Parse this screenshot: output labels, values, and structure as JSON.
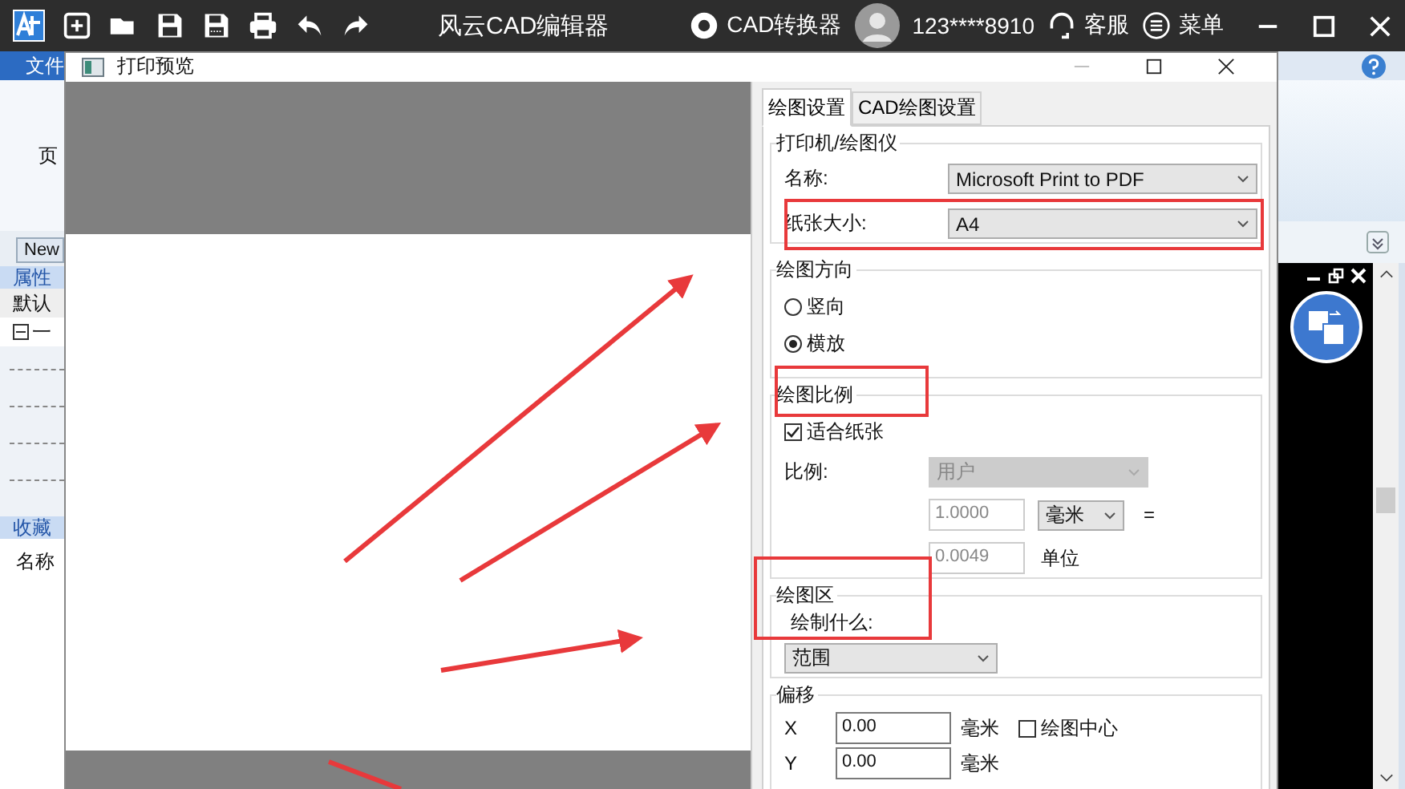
{
  "app_title_bar": {
    "title": "风云CAD编辑器",
    "converter": "CAD转换器",
    "user": "123****8910",
    "support": "客服",
    "menu": "菜单"
  },
  "background_app": {
    "menu_tab": "文件",
    "ribbon_label": "页",
    "doc_tab": "New",
    "properties_header": "属性",
    "properties_default": "默认",
    "tree_item": "一",
    "favorites_header": "收藏",
    "favorites_name": "名称"
  },
  "dialog": {
    "title": "打印预览",
    "tabs": [
      {
        "label": "绘图设置",
        "selected": true
      },
      {
        "label": "CAD绘图设置",
        "selected": false
      }
    ],
    "printer_group": {
      "title": "打印机/绘图仪",
      "name_label": "名称:",
      "name_value": "Microsoft Print to PDF",
      "paper_label": "纸张大小:",
      "paper_value": "A4"
    },
    "orientation_group": {
      "title": "绘图方向",
      "options": [
        {
          "label": "竖向",
          "selected": false
        },
        {
          "label": "横放",
          "selected": true
        }
      ]
    },
    "scale_group": {
      "title": "绘图比例",
      "fit_paper": {
        "label": "适合纸张",
        "checked": true
      },
      "scale_label": "比例:",
      "scale_select": {
        "value": "用户",
        "disabled": true
      },
      "mm_field": {
        "value": "1.0000",
        "disabled": true
      },
      "mm_unit": "毫米",
      "equals": "=",
      "unit_field": {
        "value": "0.0049",
        "disabled": true
      },
      "unit_label": "单位"
    },
    "area_group": {
      "title": "绘图区",
      "what_label": "绘制什么:",
      "what_value": "范围"
    },
    "offset_group": {
      "title": "偏移",
      "rows": [
        {
          "axis": "X",
          "value": "0.00",
          "unit": "毫米"
        },
        {
          "axis": "Y",
          "value": "0.00",
          "unit": "毫米"
        }
      ],
      "center": {
        "label": "绘图中心",
        "checked": false
      }
    }
  }
}
